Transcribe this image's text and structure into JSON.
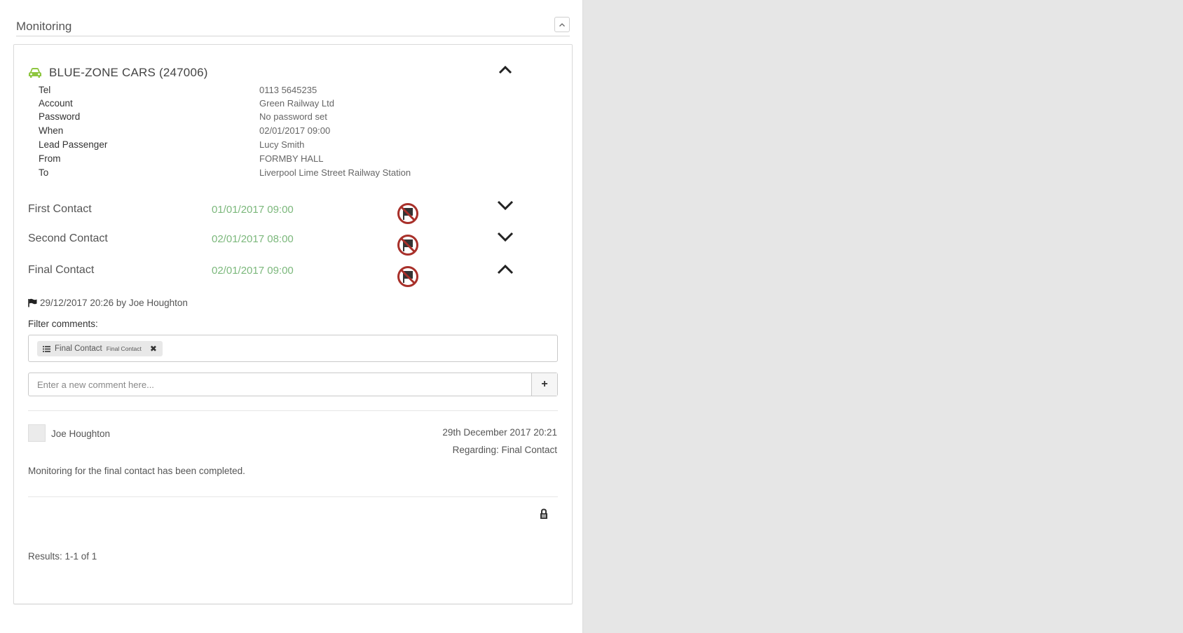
{
  "panel": {
    "title": "Monitoring",
    "collapse_icon": "chevron-up-icon"
  },
  "supplier": {
    "icon": "car-icon",
    "name": "BLUE-ZONE CARS (247006)",
    "color": "#8dc63f"
  },
  "details": [
    {
      "label": "Tel",
      "value": "0113 5645235"
    },
    {
      "label": "Account",
      "value": "Green Railway Ltd"
    },
    {
      "label": "Password",
      "value": "No password set"
    },
    {
      "label": "When",
      "value": "02/01/2017 09:00"
    },
    {
      "label": "Lead Passenger",
      "value": "Lucy Smith"
    },
    {
      "label": "From",
      "value": "FORMBY HALL"
    },
    {
      "label": "To",
      "value": "Liverpool Lime Street Railway Station"
    }
  ],
  "contacts": [
    {
      "label": "First Contact",
      "time": "01/01/2017 09:00",
      "icon": "no-flag-icon",
      "expanded": false
    },
    {
      "label": "Second Contact",
      "time": "02/01/2017 08:00",
      "icon": "no-flag-icon",
      "expanded": false
    },
    {
      "label": "Final Contact",
      "time": "02/01/2017 09:00",
      "icon": "no-flag-icon",
      "expanded": true
    }
  ],
  "flag_entry": {
    "icon": "flag-icon",
    "text": "29/12/2017 20:26 by Joe Houghton"
  },
  "filter": {
    "label": "Filter comments:",
    "chip_icon": "list-icon",
    "chip_label": "Final Contact",
    "chip_sub": "Final Contact",
    "chip_close": "✖"
  },
  "comment_input": {
    "placeholder": "Enter a new comment here...",
    "add_label": "+"
  },
  "comment": {
    "author": "Joe Houghton",
    "date": "29th December 2017 20:21",
    "regarding": "Regarding: Final Contact",
    "body": "Monitoring for the final contact has been completed.",
    "lock_icon": "lock-icon"
  },
  "results": "Results: 1-1 of 1",
  "colors": {
    "contact_time": "#7cb87c",
    "no_flag_icon": "#a8302a",
    "background": "#e6e6e6"
  }
}
